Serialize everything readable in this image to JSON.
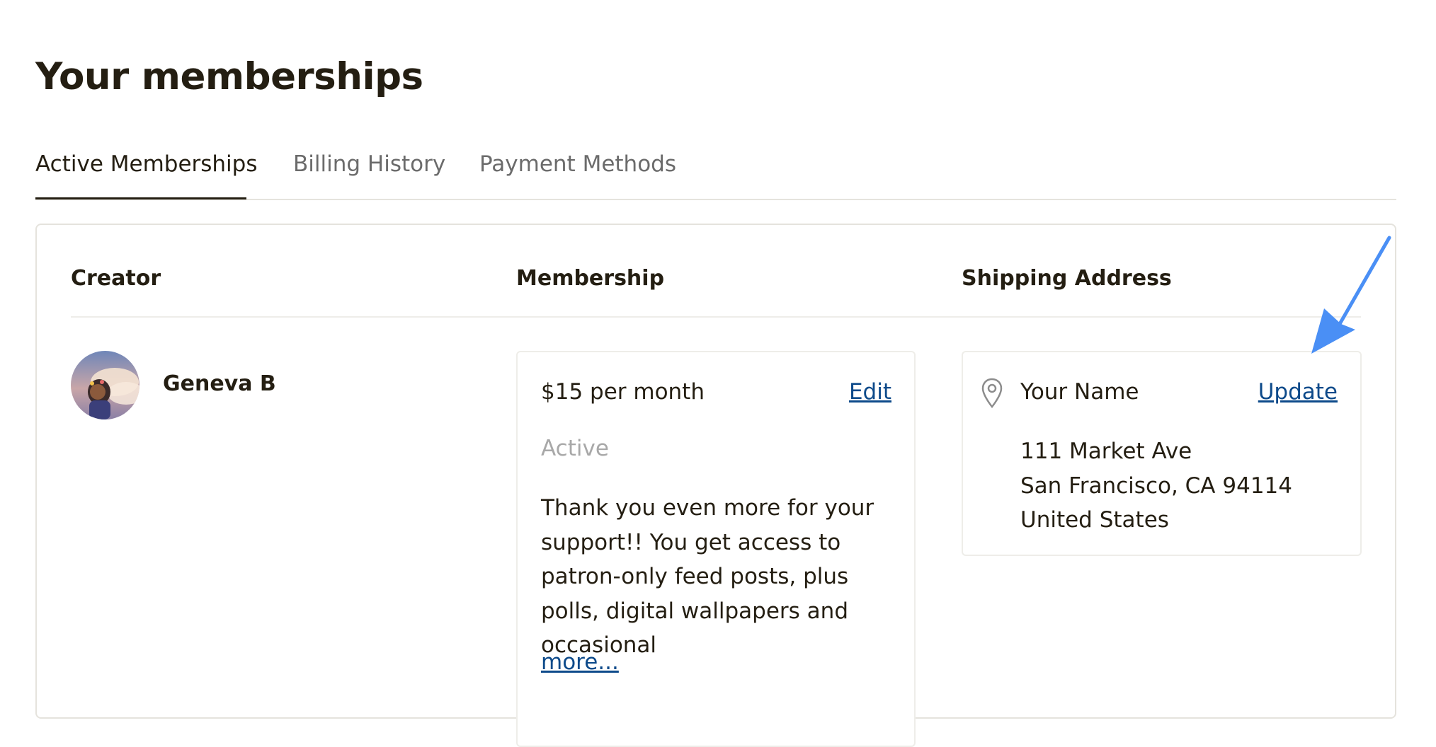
{
  "page": {
    "title": "Your memberships"
  },
  "tabs": [
    {
      "label": "Active Memberships",
      "active": true
    },
    {
      "label": "Billing History",
      "active": false
    },
    {
      "label": "Payment Methods",
      "active": false
    }
  ],
  "table": {
    "headers": {
      "creator": "Creator",
      "membership": "Membership",
      "shipping": "Shipping Address"
    }
  },
  "creator": {
    "name": "Geneva B"
  },
  "membership": {
    "price": "$15 per month",
    "edit_label": "Edit",
    "status": "Active",
    "description": "Thank you even more for your support!! You get access to patron-only feed posts, plus polls, digital wallpapers and occasional",
    "more_label": "more..."
  },
  "shipping": {
    "name": "Your Name",
    "update_label": "Update",
    "street": "111 Market Ave",
    "city_line": "San Francisco, CA 94114",
    "country": "United States"
  },
  "icons": {
    "location": "location-pin-icon",
    "annotation": "arrow-icon"
  },
  "colors": {
    "text": "#241e12",
    "link": "#0d4a8a",
    "muted": "#a8a8a8",
    "annotation": "#4a8ff5"
  }
}
